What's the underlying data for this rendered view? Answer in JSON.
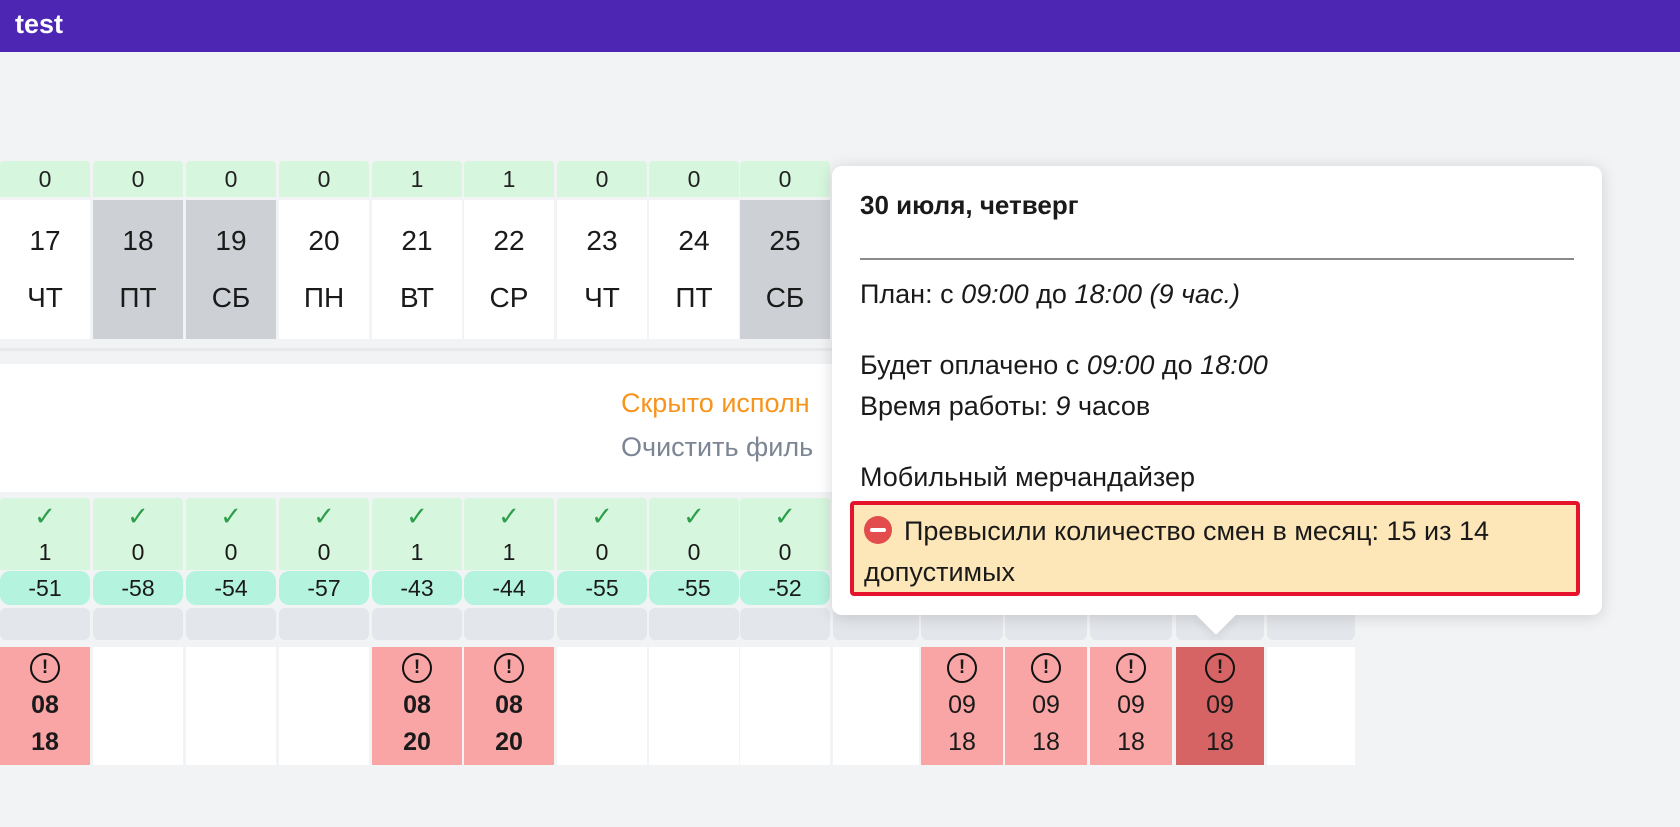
{
  "app": {
    "title": "test"
  },
  "days": [
    {
      "count": "0",
      "date": "17",
      "dow": "ЧТ",
      "weekend": false,
      "check": true,
      "count2": "1",
      "balance": "-51",
      "shift": {
        "start": "08",
        "end": "18",
        "bold": true,
        "warn": true,
        "style": "red"
      }
    },
    {
      "count": "0",
      "date": "18",
      "dow": "ПТ",
      "weekend": true,
      "check": true,
      "count2": "0",
      "balance": "-58",
      "shift": null
    },
    {
      "count": "0",
      "date": "19",
      "dow": "СБ",
      "weekend": true,
      "check": true,
      "count2": "0",
      "balance": "-54",
      "shift": null
    },
    {
      "count": "0",
      "date": "20",
      "dow": "ПН",
      "weekend": false,
      "check": true,
      "count2": "0",
      "balance": "-57",
      "shift": null
    },
    {
      "count": "1",
      "date": "21",
      "dow": "ВТ",
      "weekend": false,
      "check": true,
      "count2": "1",
      "balance": "-43",
      "shift": {
        "start": "08",
        "end": "20",
        "bold": true,
        "warn": true,
        "style": "red"
      }
    },
    {
      "count": "1",
      "date": "22",
      "dow": "СР",
      "weekend": false,
      "check": true,
      "count2": "1",
      "balance": "-44",
      "shift": {
        "start": "08",
        "end": "20",
        "bold": true,
        "warn": true,
        "style": "red"
      }
    },
    {
      "count": "0",
      "date": "23",
      "dow": "ЧТ",
      "weekend": false,
      "check": true,
      "count2": "0",
      "balance": "-55",
      "shift": null
    },
    {
      "count": "0",
      "date": "24",
      "dow": "ПТ",
      "weekend": false,
      "check": true,
      "count2": "0",
      "balance": "-55",
      "shift": null
    },
    {
      "count": "0",
      "date": "25",
      "dow": "СБ",
      "weekend": true,
      "check": true,
      "count2": "0",
      "balance": "-52",
      "shift": null
    },
    {
      "count": "",
      "date": "",
      "dow": "",
      "weekend": false,
      "check": false,
      "count2": "",
      "balance": "",
      "shift": null
    },
    {
      "count": "",
      "date": "",
      "dow": "",
      "weekend": false,
      "check": false,
      "count2": "",
      "balance": "",
      "shift": {
        "start": "09",
        "end": "18",
        "bold": false,
        "warn": true,
        "style": "red"
      }
    },
    {
      "count": "",
      "date": "",
      "dow": "",
      "weekend": false,
      "check": false,
      "count2": "",
      "balance": "",
      "shift": {
        "start": "09",
        "end": "18",
        "bold": false,
        "warn": true,
        "style": "red"
      }
    },
    {
      "count": "",
      "date": "",
      "dow": "",
      "weekend": false,
      "check": false,
      "count2": "",
      "balance": "",
      "shift": {
        "start": "09",
        "end": "18",
        "bold": false,
        "warn": true,
        "style": "red"
      }
    },
    {
      "count": "",
      "date": "",
      "dow": "",
      "weekend": false,
      "check": false,
      "count2": "",
      "balance": "",
      "shift": {
        "start": "09",
        "end": "18",
        "bold": false,
        "warn": true,
        "style": "dark"
      }
    },
    {
      "count": "",
      "date": "",
      "dow": "",
      "weekend": false,
      "check": false,
      "count2": "",
      "balance": "",
      "shift": null
    }
  ],
  "filters": {
    "hidden_text": "Скрыто исполн",
    "clear_text": "Очистить филь"
  },
  "tooltip": {
    "date_heading": "30 июля, четверг",
    "plan_prefix": "План: с ",
    "plan_from": "09:00",
    "plan_mid": " до ",
    "plan_to": "18:00",
    "plan_hours": " (9 час.)",
    "paid_prefix": "Будет оплачено с ",
    "paid_from": "09:00",
    "paid_mid": " до ",
    "paid_to": "18:00",
    "work_prefix": "Время работы: ",
    "work_hours": "9",
    "work_suffix": " часов",
    "role": "Мобильный мерчандайзер",
    "warning": "Превысили количество смен в месяц: 15 из 14 допустимых"
  },
  "colors": {
    "topbar": "#4d27b3",
    "count_bg": "#d7f6de",
    "balance_bg": "#b4f3dd",
    "weekend_bg": "#cdd1d6",
    "shift_warn_bg": "#f9a5a5",
    "shift_selected_bg": "#d66464",
    "warning_bg": "#fde7b8",
    "warning_border": "#e5132b",
    "link_orange": "#f7941d"
  },
  "icons": {
    "check": "check-icon",
    "alert": "alert-circle-icon",
    "stop": "no-entry-icon"
  }
}
